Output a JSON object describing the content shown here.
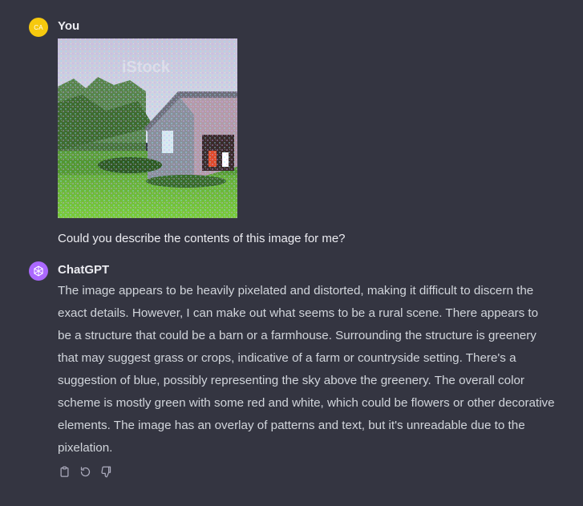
{
  "user_message": {
    "avatar_initials": "CA",
    "author": "You",
    "attachment_icon": "image-thumbnail",
    "text": "Could you describe the contents of this image for me?",
    "attachment_overlay_text": "iStock"
  },
  "assistant_message": {
    "author": "ChatGPT",
    "avatar_icon": "openai-logo-icon",
    "text": "The image appears to be heavily pixelated and distorted, making it difficult to discern the exact details. However, I can make out what seems to be a rural scene. There appears to be a structure that could be a barn or a farmhouse. Surrounding the structure is greenery that may suggest grass or crops, indicative of a farm or countryside setting. There's a suggestion of blue, possibly representing the sky above the greenery. The overall color scheme is mostly green with some red and white, which could be flowers or other decorative elements. The image has an overlay of patterns and text, but it's unreadable due to the pixelation.",
    "actions": [
      "copy-icon",
      "regenerate-icon",
      "thumbs-down-icon"
    ]
  },
  "colors": {
    "background": "#343541",
    "user_avatar": "#f6c90e",
    "assistant_avatar": "#ab68ff",
    "text_primary": "#ececf1",
    "text_secondary": "#d1d5db",
    "icon": "#acacbe"
  }
}
